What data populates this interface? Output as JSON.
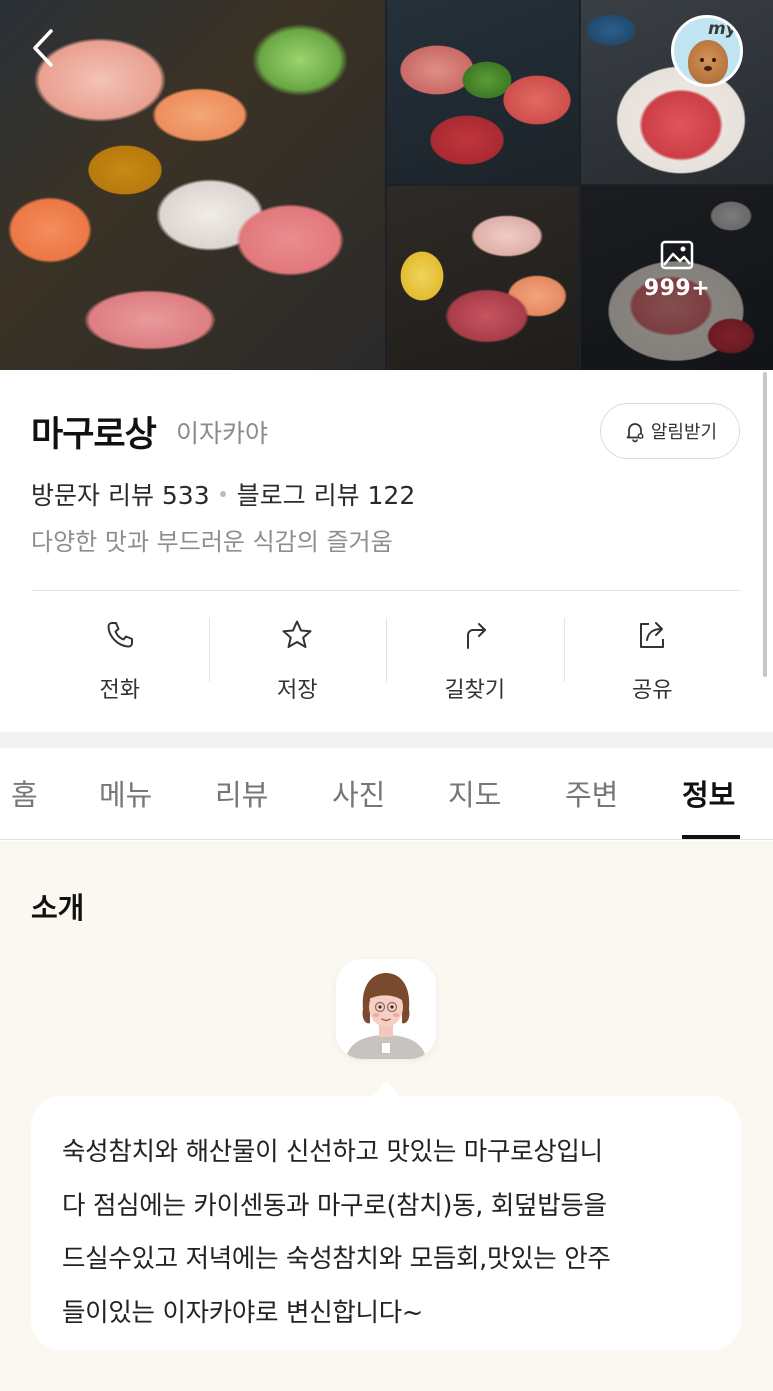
{
  "gallery": {
    "photo_count": "999+",
    "my_badge": "my"
  },
  "place": {
    "name": "마구로상",
    "category": "이자카야",
    "alarm_label": "알림받기",
    "visitor_reviews": "방문자 리뷰 533",
    "blog_reviews": "블로그 리뷰 122",
    "tagline": "다양한 맛과 부드러운 식감의 즐거움"
  },
  "actions": [
    {
      "label": "전화",
      "icon": "phone-icon"
    },
    {
      "label": "저장",
      "icon": "star-icon"
    },
    {
      "label": "길찾기",
      "icon": "directions-icon"
    },
    {
      "label": "공유",
      "icon": "share-icon"
    }
  ],
  "tabs": [
    {
      "label": "홈"
    },
    {
      "label": "메뉴"
    },
    {
      "label": "리뷰"
    },
    {
      "label": "사진"
    },
    {
      "label": "지도"
    },
    {
      "label": "주변"
    },
    {
      "label": "정보"
    }
  ],
  "active_tab": "정보",
  "intro": {
    "title": "소개",
    "lines": [
      "숙성참치와 해산물이 신선하고 맛있는 마구로상입니",
      "다 점심에는 카이센동과 마구로(참치)동, 회덮밥등을",
      "드실수있고 저녁에는 숙성참치와 모듬회,맛있는 안주",
      "들이있는 이자카야로 변신합니다~"
    ]
  },
  "colors": {
    "intro_background": "#fbf8f2",
    "tab_active": "#111111",
    "tab_inactive": "#777777"
  }
}
